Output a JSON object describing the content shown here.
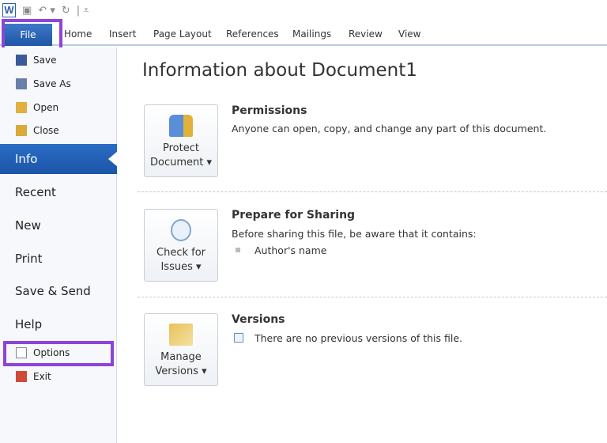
{
  "qat": {
    "app_icon": "W"
  },
  "tabs": [
    "File",
    "Home",
    "Insert",
    "Page Layout",
    "References",
    "Mailings",
    "Review",
    "View"
  ],
  "sidebar": {
    "small_top": [
      "Save",
      "Save As",
      "Open",
      "Close"
    ],
    "selected": "Info",
    "large": [
      "Recent",
      "New",
      "Print",
      "Save & Send",
      "Help"
    ],
    "small_bottom": [
      "Options",
      "Exit"
    ]
  },
  "main": {
    "title": "Information about Document1",
    "sections": [
      {
        "button": [
          "Protect",
          "Document ▾"
        ],
        "heading": "Permissions",
        "text": "Anyone can open, copy, and change any part of this document."
      },
      {
        "button": [
          "Check for",
          "Issues ▾"
        ],
        "heading": "Prepare for Sharing",
        "text": "Before sharing this file, be aware that it contains:",
        "bullet": "Author's name"
      },
      {
        "button": [
          "Manage",
          "Versions ▾"
        ],
        "heading": "Versions",
        "text": "There are no previous versions of this file."
      }
    ]
  },
  "colors": {
    "accent": "#1f56a6",
    "highlight": "#8e44d6"
  }
}
